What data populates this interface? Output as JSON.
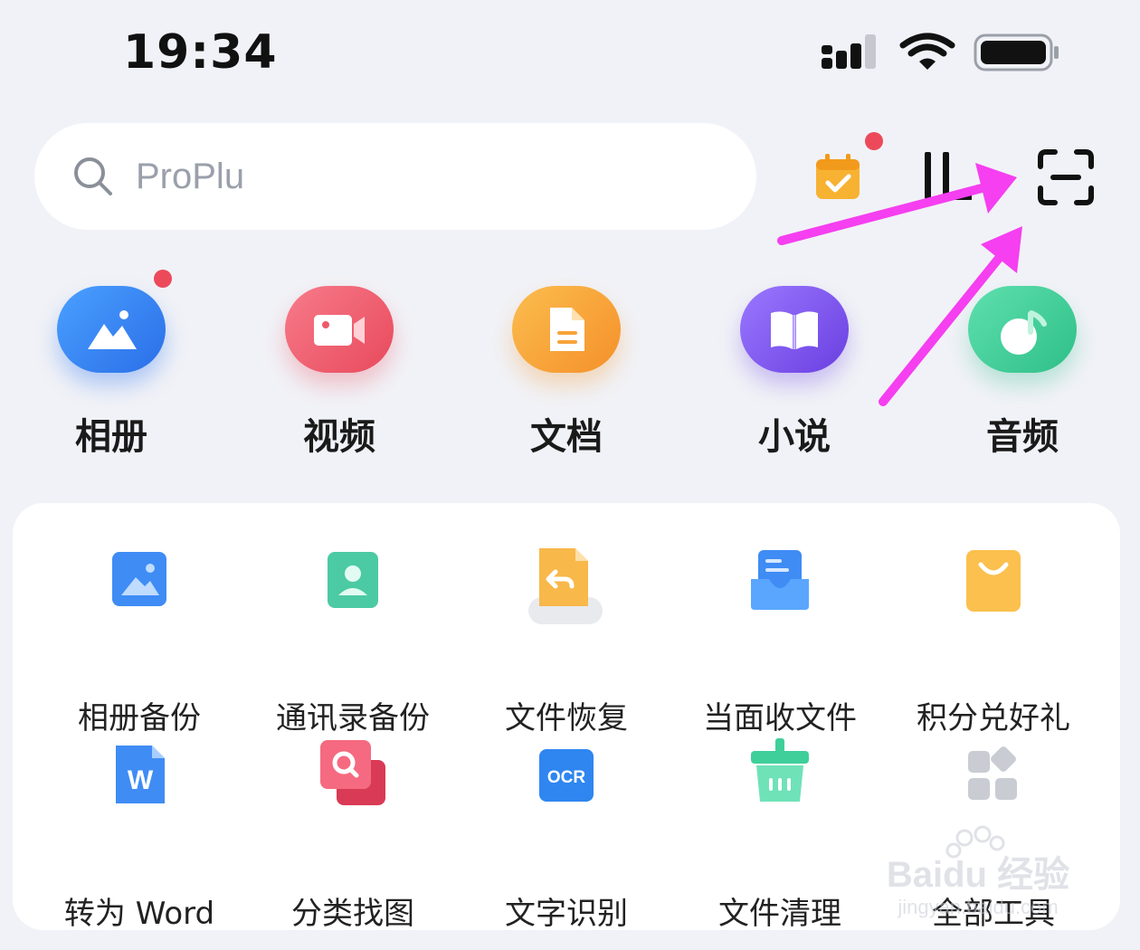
{
  "status_bar": {
    "time": "19:34"
  },
  "search": {
    "placeholder": "ProPlu"
  },
  "categories": [
    {
      "label": "相册",
      "color": "#3a86f5",
      "badge": true
    },
    {
      "label": "视频",
      "color": "#ef5a6a",
      "badge": false
    },
    {
      "label": "文档",
      "color": "#f8a23a",
      "badge": false
    },
    {
      "label": "小说",
      "color": "#7b55e8",
      "badge": false
    },
    {
      "label": "音频",
      "color": "#3fcf9a",
      "badge": false
    }
  ],
  "tools_row1": [
    "相册备份",
    "通讯录备份",
    "文件恢复",
    "当面收文件",
    "积分兑好礼"
  ],
  "tools_row2": [
    "转为 Word",
    "分类找图",
    "文字识别",
    "文件清理",
    "全部工具"
  ],
  "icons": {
    "ocr_text": "OCR",
    "word_letter": "W"
  },
  "watermark": {
    "brand": "Baidu 经验",
    "url": "jingyan.baidu.com"
  },
  "colors": {
    "accent_red": "#ec4a5a",
    "annotation_arrow": "#f53ff0"
  }
}
